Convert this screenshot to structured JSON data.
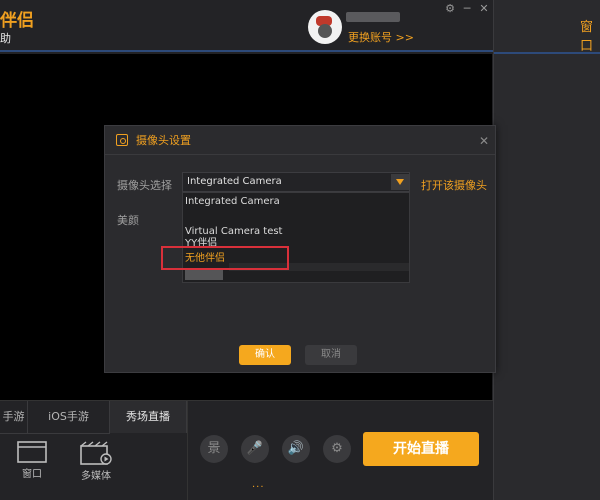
{
  "app": {
    "brand": "伴侣",
    "brand_sub": "助",
    "switch_account": "更换账号 >>",
    "window_controls": [
      "⚙",
      "─",
      "✕"
    ]
  },
  "right_panel": {
    "tab_label": "窗口"
  },
  "bottom": {
    "tabs": [
      {
        "label": "手游"
      },
      {
        "label": "iOS手游"
      },
      {
        "label": "秀场直播"
      }
    ],
    "sources": [
      {
        "label": "窗口",
        "icon": "window-icon"
      },
      {
        "label": "多媒体",
        "icon": "media-icon"
      }
    ],
    "controls": [
      {
        "glyph": "景",
        "icon": "scene-icon"
      },
      {
        "glyph": "🎤",
        "icon": "microphone-icon"
      },
      {
        "glyph": "🔊",
        "icon": "speaker-icon"
      },
      {
        "glyph": "⚙",
        "icon": "settings-icon"
      }
    ],
    "start_label": "开始直播",
    "dots": "..."
  },
  "dialog": {
    "title": "摄像头设置",
    "close": "✕",
    "camera_label": "摄像头选择",
    "camera_value": "Integrated Camera",
    "open_camera": "打开该摄像头",
    "beauty_label": "美颜",
    "options": [
      "Integrated Camera",
      "Virtual Camera test",
      "YY伴侣",
      "无他伴侣"
    ],
    "ok_label": "确认",
    "cancel_label": "取消"
  },
  "colors": {
    "accent": "#f5a81e",
    "highlight_box": "#d9303a"
  }
}
